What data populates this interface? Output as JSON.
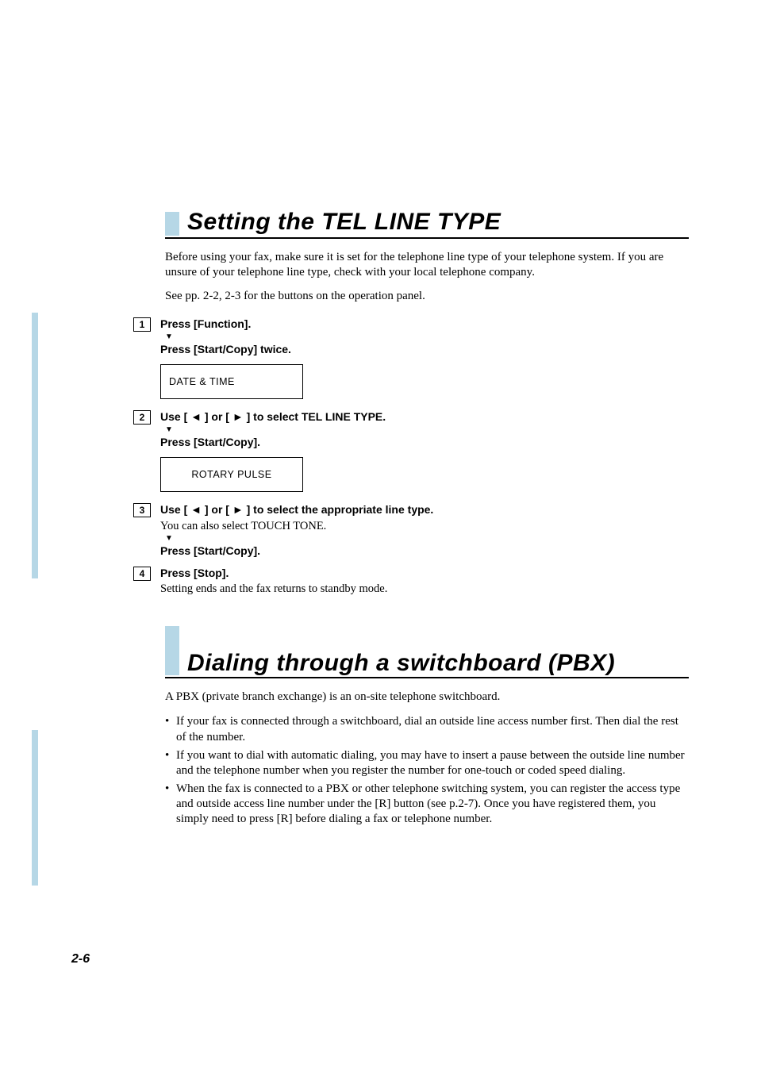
{
  "section1": {
    "title": "Setting the TEL LINE TYPE",
    "intro": "Before using your fax, make sure it is set for the telephone line type of your telephone system. If you are unsure of your telephone line type, check with your local telephone company.",
    "see": "See pp. 2-2, 2-3 for the buttons on the operation panel.",
    "steps": [
      {
        "num": "1",
        "line1": "Press [Function].",
        "line2": "Press [Start/Copy] twice.",
        "lcd": "DATE & TIME"
      },
      {
        "num": "2",
        "line1": "Use [ ◄ ] or [ ► ] to select TEL LINE TYPE.",
        "line2": "Press [Start/Copy].",
        "lcd": "ROTARY PULSE"
      },
      {
        "num": "3",
        "line1": "Use [ ◄ ] or [ ► ] to select the appropriate line type.",
        "sub": "You can also select TOUCH TONE.",
        "line2": "Press [Start/Copy]."
      },
      {
        "num": "4",
        "line1": "Press [Stop].",
        "sub": "Setting ends and the fax returns to standby mode."
      }
    ]
  },
  "section2": {
    "title": "Dialing through a switchboard (PBX)",
    "intro": "A PBX (private branch exchange) is an on-site telephone switchboard.",
    "bullets": [
      "If your fax is connected through a switchboard, dial an outside line access number first. Then dial the rest of the number.",
      "If you want to dial with automatic dialing, you may have to insert a pause between the outside line number and the telephone number when you register the number for one-touch or coded speed dialing.",
      "When the fax is connected to a PBX or other telephone switching system, you can register the access type and outside access line number under the [R] button (see p.2-7). Once you have registered them, you simply need to press [R] before dialing a fax or telephone number."
    ]
  },
  "page_number": "2-6"
}
